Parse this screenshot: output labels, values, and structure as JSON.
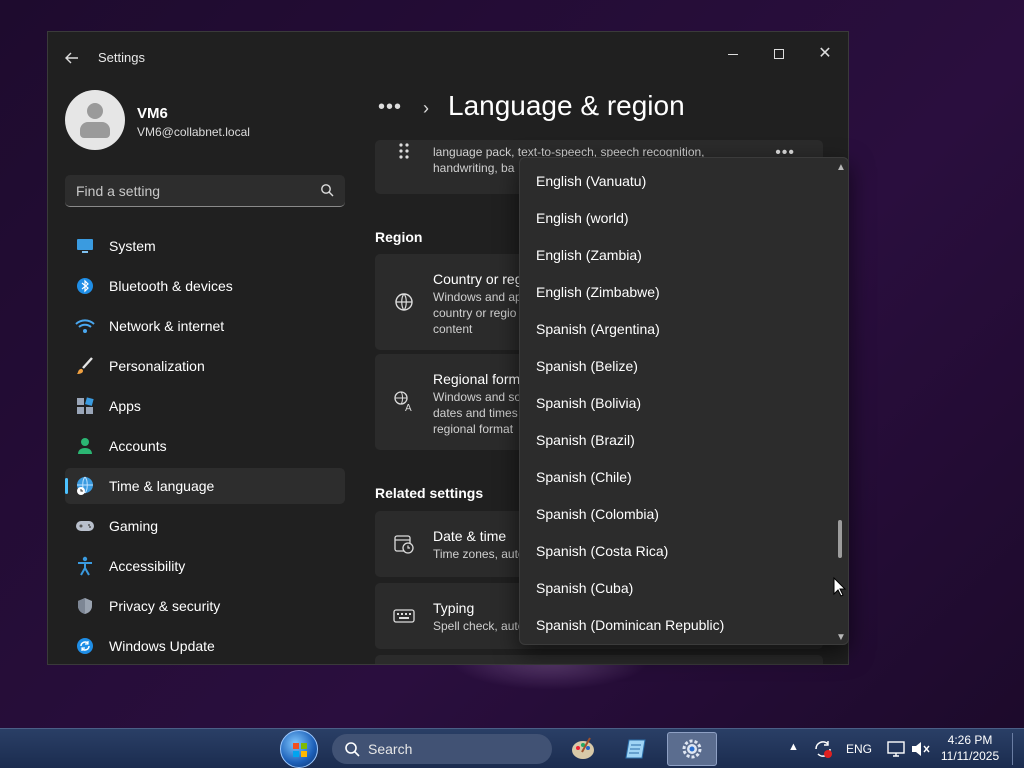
{
  "window": {
    "app_title": "Settings",
    "user": {
      "name": "VM6",
      "email": "VM6@collabnet.local"
    },
    "search_placeholder": "Find a setting"
  },
  "nav": [
    {
      "label": "System",
      "icon": "monitor-icon"
    },
    {
      "label": "Bluetooth & devices",
      "icon": "bluetooth-icon"
    },
    {
      "label": "Network & internet",
      "icon": "wifi-icon"
    },
    {
      "label": "Personalization",
      "icon": "brush-icon"
    },
    {
      "label": "Apps",
      "icon": "apps-icon"
    },
    {
      "label": "Accounts",
      "icon": "person-icon"
    },
    {
      "label": "Time & language",
      "icon": "globe-clock-icon",
      "selected": true
    },
    {
      "label": "Gaming",
      "icon": "gamepad-icon"
    },
    {
      "label": "Accessibility",
      "icon": "accessibility-icon"
    },
    {
      "label": "Privacy & security",
      "icon": "shield-icon"
    },
    {
      "label": "Windows Update",
      "icon": "update-icon"
    }
  ],
  "main": {
    "breadcrumb_more": "•••",
    "page_title": "Language & region",
    "language_card": {
      "desc_line1": "language pack, text-to-speech, speech recognition,",
      "desc_line2": "handwriting, ba"
    },
    "region_heading": "Region",
    "country_card": {
      "title": "Country or reg",
      "desc_line1": "Windows and ap",
      "desc_line2": "country or regio",
      "desc_line3": "content"
    },
    "regional_card": {
      "title": "Regional form",
      "desc_line1": "Windows and so",
      "desc_line2": "dates and times",
      "desc_line3": "regional format"
    },
    "related_heading": "Related settings",
    "date_time_card": {
      "title": "Date & time",
      "desc": "Time zones, auto"
    },
    "typing_card": {
      "title": "Typing",
      "desc": "Spell check, auto"
    }
  },
  "dropdown": {
    "items": [
      "English (Vanuatu)",
      "English (world)",
      "English (Zambia)",
      "English (Zimbabwe)",
      "Spanish (Argentina)",
      "Spanish (Belize)",
      "Spanish (Bolivia)",
      "Spanish (Brazil)",
      "Spanish (Chile)",
      "Spanish (Colombia)",
      "Spanish (Costa Rica)",
      "Spanish (Cuba)",
      "Spanish (Dominican Republic)"
    ],
    "scroll_position": 0.83
  },
  "taskbar": {
    "search_label": "Search",
    "language": "ENG",
    "time": "4:26 PM",
    "date": "11/11/2025"
  },
  "colors": {
    "accent": "#4cc2ff",
    "window_bg": "#202020",
    "card_bg": "#2b2b2b",
    "dropdown_bg": "#2c2c2c"
  }
}
